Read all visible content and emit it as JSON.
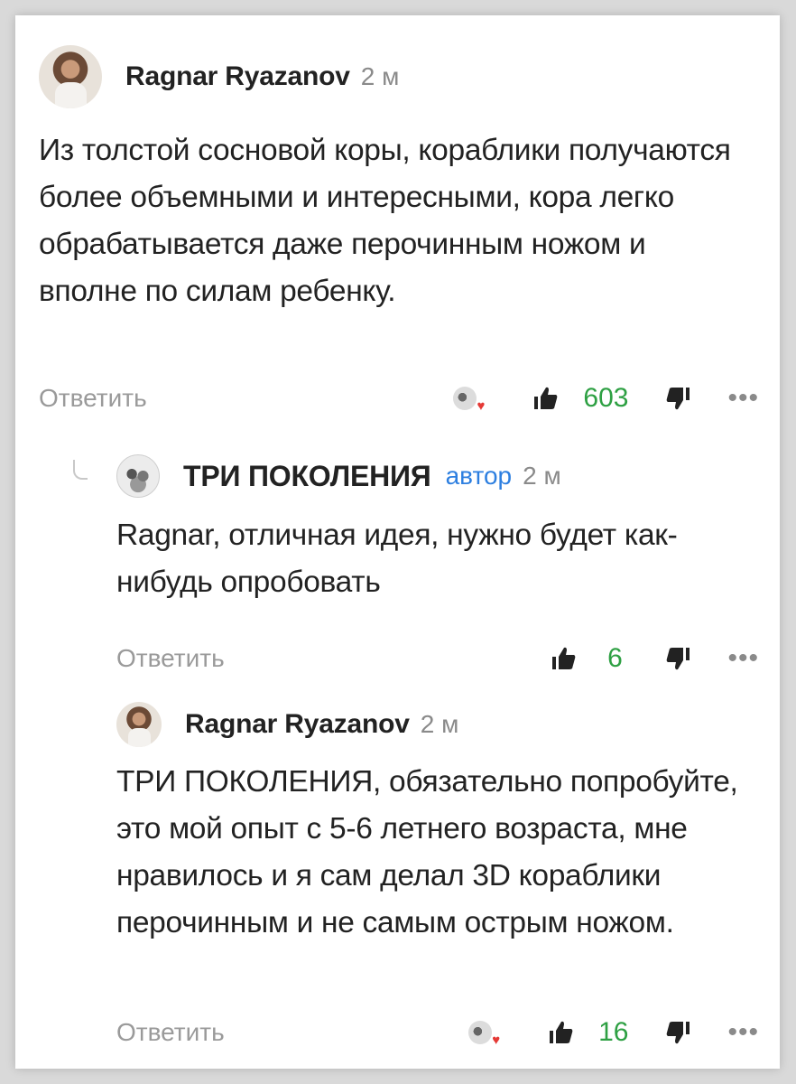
{
  "comments": [
    {
      "author": "Ragnar Ryazanov",
      "author_badge": "",
      "time": "2 м",
      "text": "Из толстой сосновой коры, кораблики получаются более объемными и интересными, кора легко обрабатывается даже перочинным ножом и вполне по силам ребенку.",
      "reply_label": "Ответить",
      "likes": "603",
      "liked_by_author": true,
      "avatar_icon": "person-avatar"
    },
    {
      "author": "ТРИ ПОКОЛЕНИЯ",
      "author_badge": "автор",
      "time": "2 м",
      "text": "Ragnar, отличная идея, нужно будет как-нибудь опробовать",
      "reply_label": "Ответить",
      "likes": "6",
      "liked_by_author": false,
      "avatar_icon": "group-avatar"
    },
    {
      "author": "Ragnar Ryazanov",
      "author_badge": "",
      "time": "2 м",
      "text": "ТРИ ПОКОЛЕНИЯ, обязательно попробуйте, это мой опыт с 5-6 летнего возраста, мне нравилось и я сам делал 3D кораблики перочинным и не самым острым ножом.",
      "reply_label": "Ответить",
      "likes": "16",
      "liked_by_author": true,
      "avatar_icon": "person-avatar"
    }
  ],
  "icons": {
    "like": "thumb-up-icon",
    "dislike": "thumb-down-icon",
    "more": "•••",
    "heart": "♥"
  },
  "colors": {
    "like_count": "#2ea043",
    "author_badge": "#2d7fe0",
    "heart": "#e53935"
  }
}
